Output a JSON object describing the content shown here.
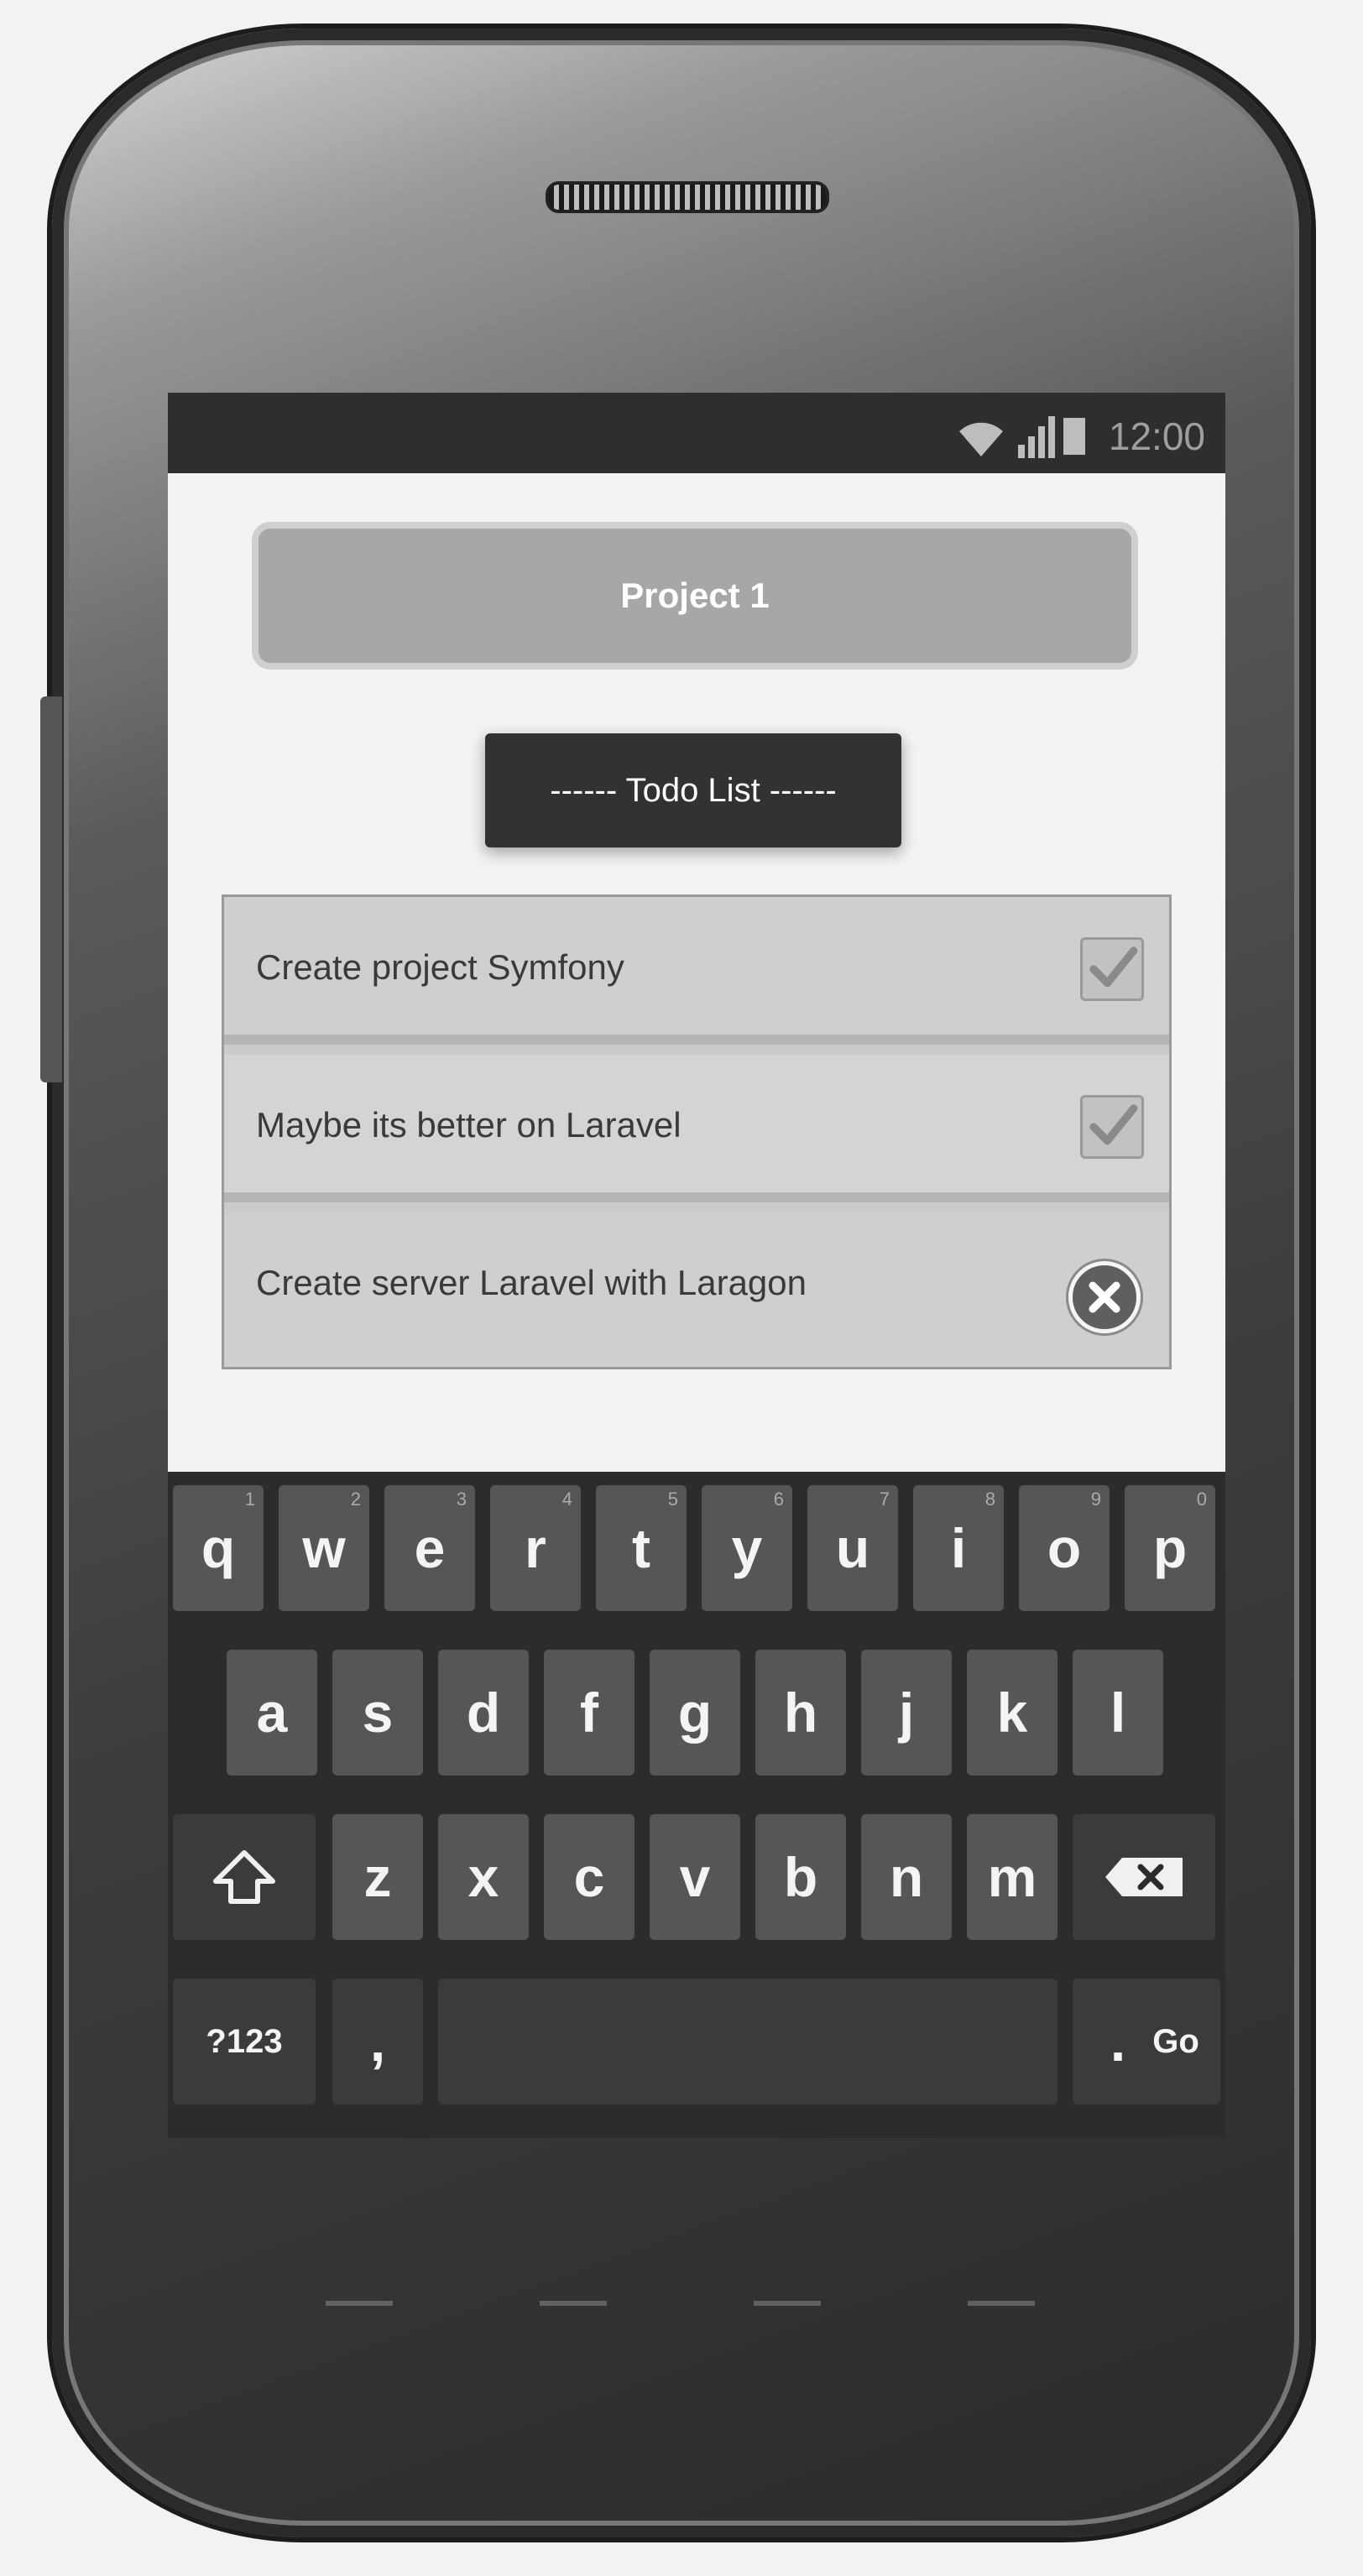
{
  "status_bar": {
    "time": "12:00",
    "icons": [
      "wifi-icon",
      "signal-icon",
      "battery-icon"
    ]
  },
  "app": {
    "project_button_label": "Project 1",
    "todo_header_label": "------ Todo List ------",
    "todo_items": [
      {
        "text": "Create project Symfony",
        "status": "checked",
        "icon": "checkbox-checked-icon"
      },
      {
        "text": "Maybe its better on Laravel",
        "status": "checked",
        "icon": "checkbox-checked-icon"
      },
      {
        "text": "Create server Laravel with Laragon",
        "status": "delete",
        "icon": "delete-circle-icon"
      }
    ]
  },
  "keyboard": {
    "row1": [
      "q",
      "w",
      "e",
      "r",
      "t",
      "y",
      "u",
      "i",
      "o",
      "p"
    ],
    "row1_hints": [
      "1",
      "2",
      "3",
      "4",
      "5",
      "6",
      "7",
      "8",
      "9",
      "0"
    ],
    "row2": [
      "a",
      "s",
      "d",
      "f",
      "g",
      "h",
      "j",
      "k",
      "l"
    ],
    "row3": [
      "z",
      "x",
      "c",
      "v",
      "b",
      "n",
      "m"
    ],
    "shift_icon": "shift-icon",
    "backspace_icon": "backspace-icon",
    "symbols_label": "?123",
    "comma_label": ",",
    "period_label": ".",
    "go_label": "Go"
  },
  "colors": {
    "status_bar": "#2e2e2e",
    "project_button": "#a7a7a7",
    "todo_header": "#323232",
    "keyboard_bg": "#2c2c2c",
    "key": "#565656"
  }
}
